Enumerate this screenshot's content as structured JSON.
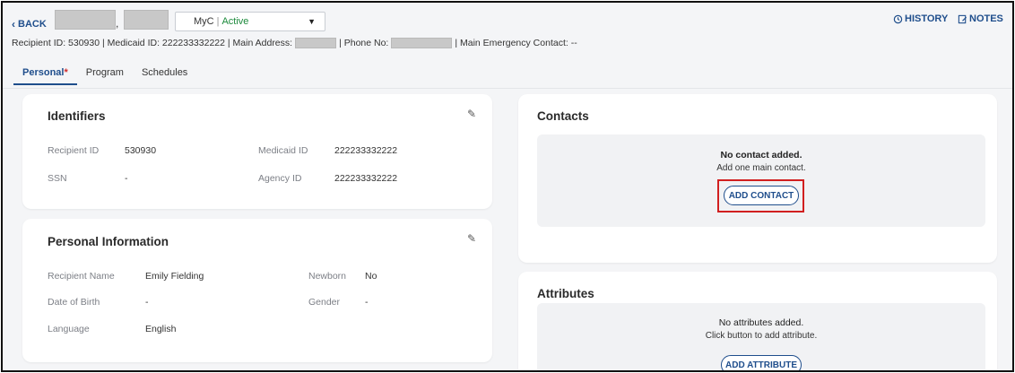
{
  "header": {
    "back_label": "BACK",
    "name_separator": ",",
    "program_select": {
      "program": "MyC",
      "separator": "|",
      "status": "Active"
    },
    "history_label": "HISTORY",
    "notes_label": "NOTES"
  },
  "infobar": {
    "part1": "Recipient ID: 530930 | Medicaid ID: 222233332222 | Main Address:",
    "part2": "| Phone No:",
    "part3": "| Main Emergency Contact: --"
  },
  "tabs": [
    {
      "label": "Personal",
      "marker": "*"
    },
    {
      "label": "Program"
    },
    {
      "label": "Schedules"
    }
  ],
  "identifiers": {
    "title": "Identifiers",
    "recipient_id_label": "Recipient ID",
    "recipient_id": "530930",
    "medicaid_id_label": "Medicaid ID",
    "medicaid_id": "222233332222",
    "ssn_label": "SSN",
    "ssn": "-",
    "agency_id_label": "Agency ID",
    "agency_id": "222233332222"
  },
  "personal_info": {
    "title": "Personal Information",
    "recipient_name_label": "Recipient Name",
    "recipient_name": "Emily Fielding",
    "newborn_label": "Newborn",
    "newborn": "No",
    "dob_label": "Date of Birth",
    "dob": "-",
    "gender_label": "Gender",
    "gender": "-",
    "language_label": "Language",
    "language": "English"
  },
  "contacts": {
    "title": "Contacts",
    "empty_title": "No contact added.",
    "empty_hint": "Add one main contact.",
    "add_button": "ADD CONTACT"
  },
  "attributes": {
    "title": "Attributes",
    "empty_title": "No attributes added.",
    "empty_hint": "Click button to add attribute.",
    "add_button": "ADD ATTRIBUTE"
  },
  "colors": {
    "accent": "#1f4e8c",
    "status_active": "#1c8a3c",
    "highlight": "#d11f1f",
    "required_marker": "#d12b2b"
  },
  "icons": [
    "chevron-left-icon",
    "caret-down-icon",
    "history-icon",
    "notes-icon",
    "pencil-icon"
  ]
}
